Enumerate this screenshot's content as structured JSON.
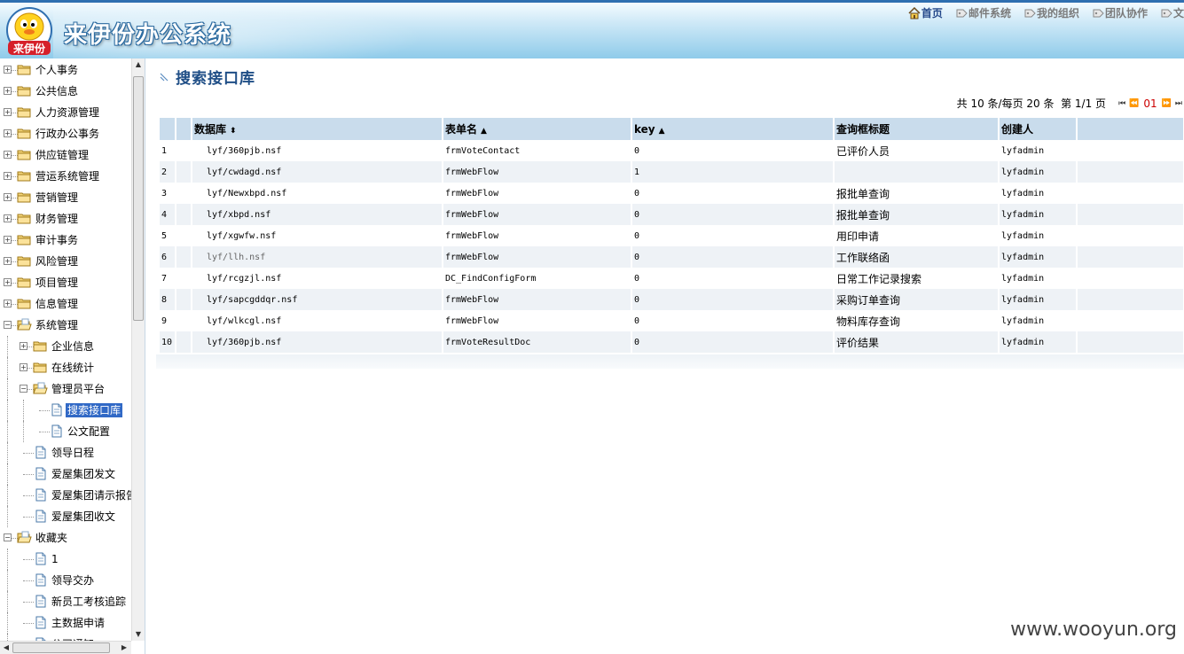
{
  "header": {
    "logo_text": "来伊份",
    "app_title": "来伊份办公系统",
    "nav": [
      {
        "label": "首页",
        "icon": "home-icon",
        "active": true
      },
      {
        "label": "邮件系统",
        "icon": "tag-icon",
        "active": false
      },
      {
        "label": "我的组织",
        "icon": "tag-icon",
        "active": false
      },
      {
        "label": "团队协作",
        "icon": "tag-icon",
        "active": false
      },
      {
        "label": "文",
        "icon": "tag-icon",
        "active": false
      }
    ]
  },
  "sidebar": {
    "items": [
      {
        "label": "个人事务",
        "level": 0,
        "type": "folder",
        "expander": "+"
      },
      {
        "label": "公共信息",
        "level": 0,
        "type": "folder",
        "expander": "+"
      },
      {
        "label": "人力资源管理",
        "level": 0,
        "type": "folder",
        "expander": "+"
      },
      {
        "label": "行政办公事务",
        "level": 0,
        "type": "folder",
        "expander": "+"
      },
      {
        "label": "供应链管理",
        "level": 0,
        "type": "folder",
        "expander": "+"
      },
      {
        "label": "营运系统管理",
        "level": 0,
        "type": "folder",
        "expander": "+"
      },
      {
        "label": "营销管理",
        "level": 0,
        "type": "folder",
        "expander": "+"
      },
      {
        "label": "财务管理",
        "level": 0,
        "type": "folder",
        "expander": "+"
      },
      {
        "label": "审计事务",
        "level": 0,
        "type": "folder",
        "expander": "+"
      },
      {
        "label": "风险管理",
        "level": 0,
        "type": "folder",
        "expander": "+"
      },
      {
        "label": "项目管理",
        "level": 0,
        "type": "folder",
        "expander": "+"
      },
      {
        "label": "信息管理",
        "level": 0,
        "type": "folder",
        "expander": "+"
      },
      {
        "label": "系统管理",
        "level": 0,
        "type": "folder-open",
        "expander": "−"
      },
      {
        "label": "企业信息",
        "level": 1,
        "type": "folder",
        "expander": "+"
      },
      {
        "label": "在线统计",
        "level": 1,
        "type": "folder",
        "expander": "+"
      },
      {
        "label": "管理员平台",
        "level": 1,
        "type": "folder-open",
        "expander": "−"
      },
      {
        "label": "搜索接口库",
        "level": 2,
        "type": "doc",
        "expander": "",
        "selected": true
      },
      {
        "label": "公文配置",
        "level": 2,
        "type": "doc",
        "expander": ""
      },
      {
        "label": "领导日程",
        "level": 1,
        "type": "doc",
        "expander": ""
      },
      {
        "label": "爱屋集团发文",
        "level": 1,
        "type": "doc",
        "expander": ""
      },
      {
        "label": "爱屋集团请示报告",
        "level": 1,
        "type": "doc",
        "expander": ""
      },
      {
        "label": "爱屋集团收文",
        "level": 1,
        "type": "doc",
        "expander": ""
      },
      {
        "label": "收藏夹",
        "level": 0,
        "type": "folder-open",
        "expander": "−"
      },
      {
        "label": "1",
        "level": 1,
        "type": "doc",
        "expander": ""
      },
      {
        "label": "领导交办",
        "level": 1,
        "type": "doc",
        "expander": ""
      },
      {
        "label": "新员工考核追踪",
        "level": 1,
        "type": "doc",
        "expander": ""
      },
      {
        "label": "主数据申请",
        "level": 1,
        "type": "doc",
        "expander": ""
      },
      {
        "label": "公司通知",
        "level": 1,
        "type": "doc",
        "expander": ""
      }
    ]
  },
  "main": {
    "page_title": "搜索接口库",
    "pager": {
      "summary": "共 10 条/每页 20 条  第 1/1 页",
      "current_page": "01"
    },
    "table": {
      "columns": [
        {
          "label": "",
          "sort": ""
        },
        {
          "label": "",
          "sort": ""
        },
        {
          "label": "数据库",
          "sort": "⬍"
        },
        {
          "label": "表单名",
          "sort": "▲"
        },
        {
          "label": "key",
          "sort": "▲"
        },
        {
          "label": "查询框标题",
          "sort": ""
        },
        {
          "label": "创建人",
          "sort": ""
        },
        {
          "label": "",
          "sort": ""
        }
      ],
      "rows": [
        {
          "num": "1",
          "db": "lyf/360pjb.nsf",
          "form": "frmVoteContact",
          "key": "0",
          "title": "已评价人员",
          "creator": "lyfadmin"
        },
        {
          "num": "2",
          "db": "lyf/cwdagd.nsf",
          "form": "frmWebFlow",
          "key": "1",
          "title": "",
          "creator": "lyfadmin"
        },
        {
          "num": "3",
          "db": "lyf/Newxbpd.nsf",
          "form": "frmWebFlow",
          "key": "0",
          "title": "报批单查询",
          "creator": "lyfadmin"
        },
        {
          "num": "4",
          "db": "lyf/xbpd.nsf",
          "form": "frmWebFlow",
          "key": "0",
          "title": "报批单查询",
          "creator": "lyfadmin"
        },
        {
          "num": "5",
          "db": "lyf/xgwfw.nsf",
          "form": "frmWebFlow",
          "key": "0",
          "title": "用印申请",
          "creator": "lyfadmin"
        },
        {
          "num": "6",
          "db": "lyf/llh.nsf",
          "form": "frmWebFlow",
          "key": "0",
          "title": "工作联络函",
          "creator": "lyfadmin"
        },
        {
          "num": "7",
          "db": "lyf/rcgzjl.nsf",
          "form": "DC_FindConfigForm",
          "key": "0",
          "title": "日常工作记录搜索",
          "creator": "lyfadmin"
        },
        {
          "num": "8",
          "db": "lyf/sapcgddqr.nsf",
          "form": "frmWebFlow",
          "key": "0",
          "title": "采购订单查询",
          "creator": "lyfadmin"
        },
        {
          "num": "9",
          "db": "lyf/wlkcgl.nsf",
          "form": "frmWebFlow",
          "key": "0",
          "title": "物料库存查询",
          "creator": "lyfadmin"
        },
        {
          "num": "10",
          "db": "lyf/360pjb.nsf",
          "form": "frmVoteResultDoc",
          "key": "0",
          "title": "评价结果",
          "creator": "lyfadmin"
        }
      ]
    }
  },
  "watermark": "www.wooyun.org",
  "colors": {
    "header_blue": "#8fcbea",
    "title_blue": "#1f4e86",
    "table_header": "#c9dcec",
    "selected": "#3169c6",
    "page_red": "#cc0000"
  }
}
